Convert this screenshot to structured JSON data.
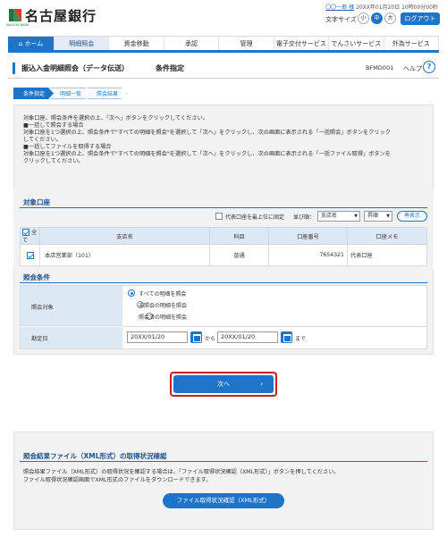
{
  "header": {
    "bank_name": "名古屋銀行",
    "bank_name_en": "NAGOYA BANK",
    "user_name": "〇〇一郎 様",
    "last_login": "20XX年01月20日 10時00分00秒",
    "font_size_label": "文字サイズ",
    "font_sizes": [
      "小",
      "中",
      "大"
    ],
    "font_size_selected": "中",
    "logout_label": "ログアウト"
  },
  "nav": {
    "items": [
      "ホーム",
      "明細照会",
      "資金移動",
      "承認",
      "管理",
      "電子交付サービス",
      "でんさいサービス",
      "外為サービス"
    ],
    "active": "明細照会"
  },
  "page": {
    "title": "振込入金明細照会（データ伝送）",
    "subtitle": "条件指定",
    "screen_id": "BFMD001",
    "help_label": "ヘルプ",
    "help_icon": "?"
  },
  "steps": [
    "条件指定",
    "明細一覧",
    "照会結果"
  ],
  "instructions": [
    "対象口座、照会条件を選択の上、「次へ」ボタンをクリックしてください。",
    "■一括して照会する場合",
    "対象口座を1つ選択の上、照会条件で\"すべての明細を照会\"を選択して「次へ」をクリックし、次の画面に表示される「一括照会」ボタンをクリック",
    "してください。",
    "■一括してファイルを取得する場合",
    "対象口座を1つ選択の上、照会条件で\"すべての明細を照会\"を選択して「次へ」をクリックし、次の画面に表示される「一括ファイル取得」ボタンを",
    "クリックしてください。"
  ],
  "account_section": {
    "heading": "対象口座",
    "pin_label": "代表口座を最上位に固定",
    "sort_label": "並び順：",
    "sort_field": "支店名",
    "sort_order": "昇順",
    "redisplay_label": "再表示",
    "columns": [
      "全て",
      "支店名",
      "科目",
      "口座番号",
      "口座メモ"
    ],
    "rows": [
      {
        "checked": true,
        "branch": "本店営業部（101）",
        "type": "普通",
        "number": "7654321",
        "memo": "代表口座"
      }
    ]
  },
  "conditions": {
    "heading": "照会条件",
    "target_label": "照会対象",
    "options": [
      "すべての明細を照会",
      "未照会の明細を照会",
      "照会済の明細を照会"
    ],
    "selected_option": 0,
    "date_label": "勘定日",
    "date_from": "20XX/01/20",
    "date_to": "20XX/01/20",
    "from_label": "から",
    "to_label": "まで"
  },
  "next_button": {
    "label": "次へ",
    "arrow": "›"
  },
  "xml_section": {
    "heading": "照会結果ファイル（XML形式）の取得状況確認",
    "text1": "照会結果ファイル（XML形式）の取得状況を確認する場合は、「ファイル取得状況確認（XML形式）」ボタンを押してください。",
    "text2": "ファイル取得状況確認画面でXML形式のファイルをダウンロードできます。",
    "button_label": "ファイル取得状況確認（XML形式）"
  },
  "colors": {
    "primary": "#1e74c9",
    "highlight": "#d01c1c",
    "logo_green": "#1a7a3a"
  }
}
